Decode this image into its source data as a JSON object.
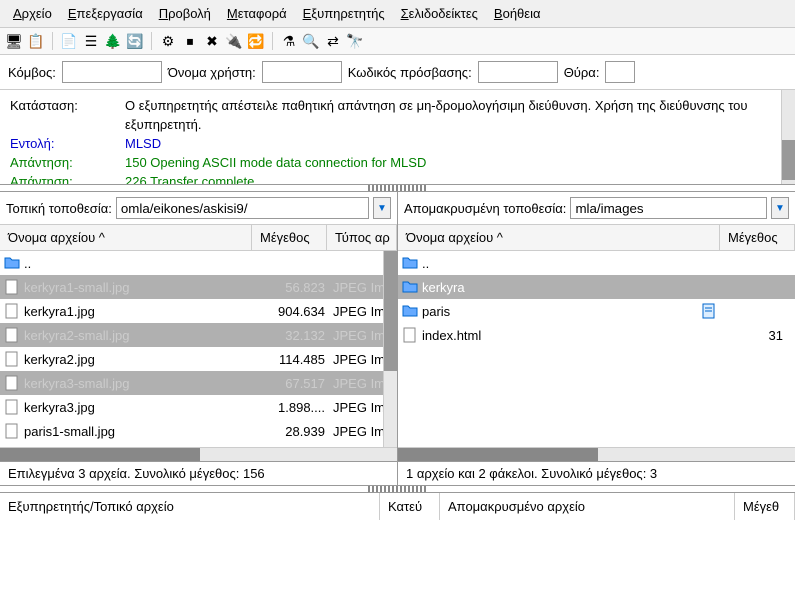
{
  "menu": [
    "Αρχείο",
    "Επεξεργασία",
    "Προβολή",
    "Μεταφορά",
    "Εξυπηρετητής",
    "Σελιδοδείκτες",
    "Βοήθεια"
  ],
  "toolbar_icons": [
    "server-icon",
    "sitemanager-icon",
    "sep",
    "page-icon",
    "list-icon",
    "tree-icon",
    "refresh-icon",
    "sep",
    "process-icon",
    "stop-icon",
    "cancel-icon",
    "disconnect-icon",
    "reconnect-icon",
    "sep",
    "filter-icon",
    "search-icon",
    "compare-icon",
    "binoculars-icon"
  ],
  "conn": {
    "host_label": "Κόμβος:",
    "user_label": "Όνομα χρήστη:",
    "pass_label": "Κωδικός πρόσβασης:",
    "port_label": "Θύρα:",
    "host": "",
    "user": "",
    "pass": "",
    "port": ""
  },
  "log": [
    {
      "label": "Κατάσταση:",
      "cls": "",
      "text": "Ο εξυπηρετητής απέστειλε παθητική απάντηση σε μη-δρομολογήσιμη διεύθυνση. Χρήση της διεύθυνσης του εξυπηρετητή."
    },
    {
      "label": "Εντολή:",
      "cls": "blue",
      "text": "MLSD"
    },
    {
      "label": "Απάντηση:",
      "cls": "green",
      "text": "150 Opening ASCII mode data connection for MLSD"
    },
    {
      "label": "Απάντηση:",
      "cls": "green",
      "text": "226 Transfer complete"
    }
  ],
  "local": {
    "label": "Τοπική τοποθεσία:",
    "path": "omla/eikones/askisi9/",
    "cols": {
      "name": "Όνομα αρχείου ^",
      "size": "Μέγεθος",
      "type": "Τύπος αρ"
    },
    "files": [
      {
        "name": "..",
        "size": "",
        "type": "",
        "icon": "folder",
        "sel": false
      },
      {
        "name": "kerkyra1-small.jpg",
        "size": "56.823",
        "type": "JPEG Im",
        "icon": "file",
        "sel": true,
        "faded": true
      },
      {
        "name": "kerkyra1.jpg",
        "size": "904.634",
        "type": "JPEG Im",
        "icon": "file",
        "sel": false
      },
      {
        "name": "kerkyra2-small.jpg",
        "size": "32.132",
        "type": "JPEG Im",
        "icon": "file",
        "sel": true,
        "faded": true
      },
      {
        "name": "kerkyra2.jpg",
        "size": "114.485",
        "type": "JPEG Im",
        "icon": "file",
        "sel": false
      },
      {
        "name": "kerkyra3-small.jpg",
        "size": "67.517",
        "type": "JPEG Im",
        "icon": "file",
        "sel": true,
        "faded": true
      },
      {
        "name": "kerkyra3.jpg",
        "size": "1.898....",
        "type": "JPEG Im",
        "icon": "file",
        "sel": false
      },
      {
        "name": "paris1-small.jpg",
        "size": "28.939",
        "type": "JPEG Im",
        "icon": "file",
        "sel": false
      }
    ],
    "status": "Επιλεγμένα 3 αρχεία. Συνολικό μέγεθος: 156"
  },
  "remote": {
    "label": "Απομακρυσμένη τοποθεσία:",
    "path": "mla/images",
    "cols": {
      "name": "Όνομα αρχείου ^",
      "size": "Μέγεθος"
    },
    "files": [
      {
        "name": "..",
        "size": "",
        "icon": "folder",
        "sel": false
      },
      {
        "name": "kerkyra",
        "size": "",
        "icon": "folder",
        "sel": true
      },
      {
        "name": "paris",
        "size": "",
        "icon": "folder",
        "sel": false,
        "extra": "doc"
      },
      {
        "name": "index.html",
        "size": "31",
        "icon": "file",
        "sel": false
      }
    ],
    "status": "1 αρχείο και 2 φάκελοι. Συνολικό μέγεθος: 3"
  },
  "queue": {
    "c1": "Εξυπηρετητής/Τοπικό αρχείο",
    "c2": "Κατεύ",
    "c3": "Απομακρυσμένο αρχείο",
    "c4": "Μέγεθ"
  }
}
